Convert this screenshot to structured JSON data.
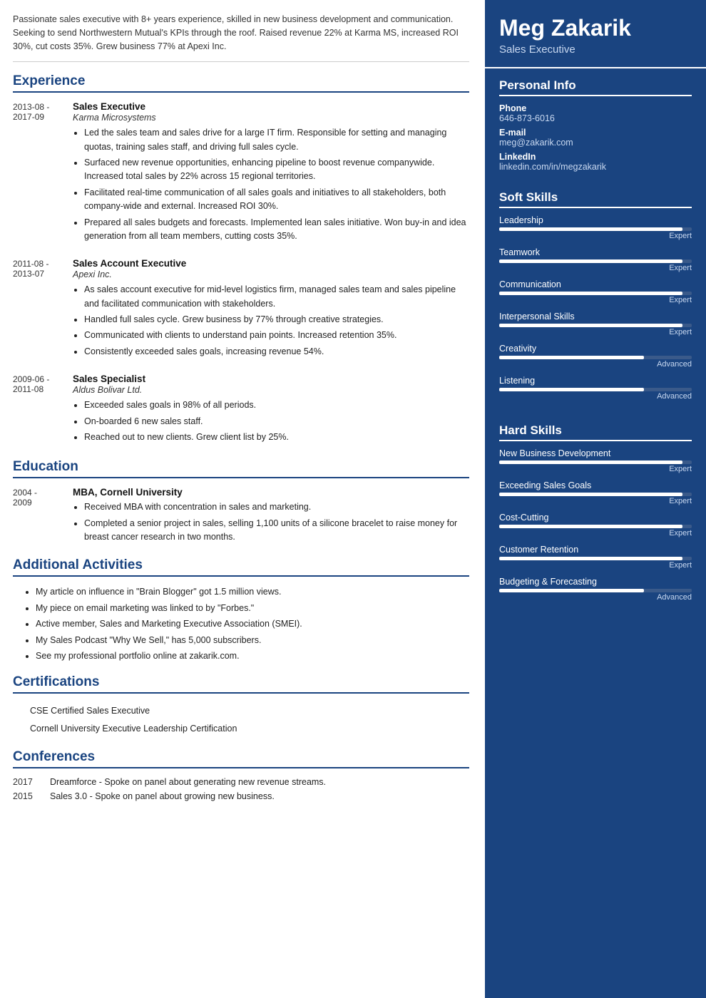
{
  "summary": "Passionate sales executive with 8+ years experience, skilled in new business development and communication. Seeking to send Northwestern Mutual's KPIs through the roof. Raised revenue 22% at Karma MS, increased ROI 30%, cut costs 35%. Grew business 77% at Apexi Inc.",
  "header": {
    "name": "Meg Zakarik",
    "title": "Sales Executive"
  },
  "personal_info": {
    "section_title": "Personal Info",
    "phone_label": "Phone",
    "phone": "646-873-6016",
    "email_label": "E-mail",
    "email": "meg@zakarik.com",
    "linkedin_label": "LinkedIn",
    "linkedin": "linkedin.com/in/megzakarik"
  },
  "soft_skills": {
    "section_title": "Soft Skills",
    "skills": [
      {
        "name": "Leadership",
        "level": "Expert",
        "pct": 95
      },
      {
        "name": "Teamwork",
        "level": "Expert",
        "pct": 95
      },
      {
        "name": "Communication",
        "level": "Expert",
        "pct": 95
      },
      {
        "name": "Interpersonal Skills",
        "level": "Expert",
        "pct": 95
      },
      {
        "name": "Creativity",
        "level": "Advanced",
        "pct": 75
      },
      {
        "name": "Listening",
        "level": "Advanced",
        "pct": 75
      }
    ]
  },
  "hard_skills": {
    "section_title": "Hard Skills",
    "skills": [
      {
        "name": "New Business Development",
        "level": "Expert",
        "pct": 95
      },
      {
        "name": "Exceeding Sales Goals",
        "level": "Expert",
        "pct": 95
      },
      {
        "name": "Cost-Cutting",
        "level": "Expert",
        "pct": 95
      },
      {
        "name": "Customer Retention",
        "level": "Expert",
        "pct": 95
      },
      {
        "name": "Budgeting & Forecasting",
        "level": "Advanced",
        "pct": 75
      }
    ]
  },
  "experience": {
    "section_title": "Experience",
    "entries": [
      {
        "dates": "2013-08 -\n2017-09",
        "title": "Sales Executive",
        "company": "Karma Microsystems",
        "bullets": [
          "Led the sales team and sales drive for a large IT firm. Responsible for setting and managing quotas, training sales staff, and driving full sales cycle.",
          "Surfaced new revenue opportunities, enhancing pipeline to boost revenue companywide. Increased total sales by 22% across 15 regional territories.",
          "Facilitated real-time communication of all sales goals and initiatives to all stakeholders, both company-wide and external. Increased ROI 30%.",
          "Prepared all sales budgets and forecasts. Implemented lean sales initiative. Won buy-in and idea generation from all team members, cutting costs 35%."
        ]
      },
      {
        "dates": "2011-08 -\n2013-07",
        "title": "Sales Account Executive",
        "company": "Apexi Inc.",
        "bullets": [
          "As sales account executive for mid-level logistics firm, managed sales team and sales pipeline and facilitated communication with stakeholders.",
          "Handled full sales cycle. Grew business by 77% through creative strategies.",
          "Communicated with clients to understand pain points. Increased retention 35%.",
          "Consistently exceeded sales goals, increasing revenue 54%."
        ]
      },
      {
        "dates": "2009-06 -\n2011-08",
        "title": "Sales Specialist",
        "company": "Aldus Bolivar Ltd.",
        "bullets": [
          "Exceeded sales goals in 98% of all periods.",
          "On-boarded 6 new sales staff.",
          "Reached out to new clients. Grew client list by 25%."
        ]
      }
    ]
  },
  "education": {
    "section_title": "Education",
    "entries": [
      {
        "dates": "2004 -\n2009",
        "degree": "MBA, Cornell University",
        "bullets": [
          "Received MBA with concentration in sales and marketing.",
          "Completed a senior project in sales, selling 1,100 units of a silicone bracelet to raise money for breast cancer research in two months."
        ]
      }
    ]
  },
  "additional_activities": {
    "section_title": "Additional Activities",
    "bullets": [
      "My article on influence in \"Brain Blogger\" got 1.5 million views.",
      "My piece on email marketing was linked to by \"Forbes.\"",
      "Active member, Sales and Marketing Executive Association (SMEI).",
      "My Sales Podcast \"Why We Sell,\" has 5,000 subscribers.",
      "See my professional portfolio online at zakarik.com."
    ]
  },
  "certifications": {
    "section_title": "Certifications",
    "items": [
      "CSE Certified Sales Executive",
      "Cornell University Executive Leadership Certification"
    ]
  },
  "conferences": {
    "section_title": "Conferences",
    "entries": [
      {
        "year": "2017",
        "desc": "Dreamforce - Spoke on panel about generating new revenue streams."
      },
      {
        "year": "2015",
        "desc": "Sales 3.0 - Spoke on panel about growing new business."
      }
    ]
  }
}
